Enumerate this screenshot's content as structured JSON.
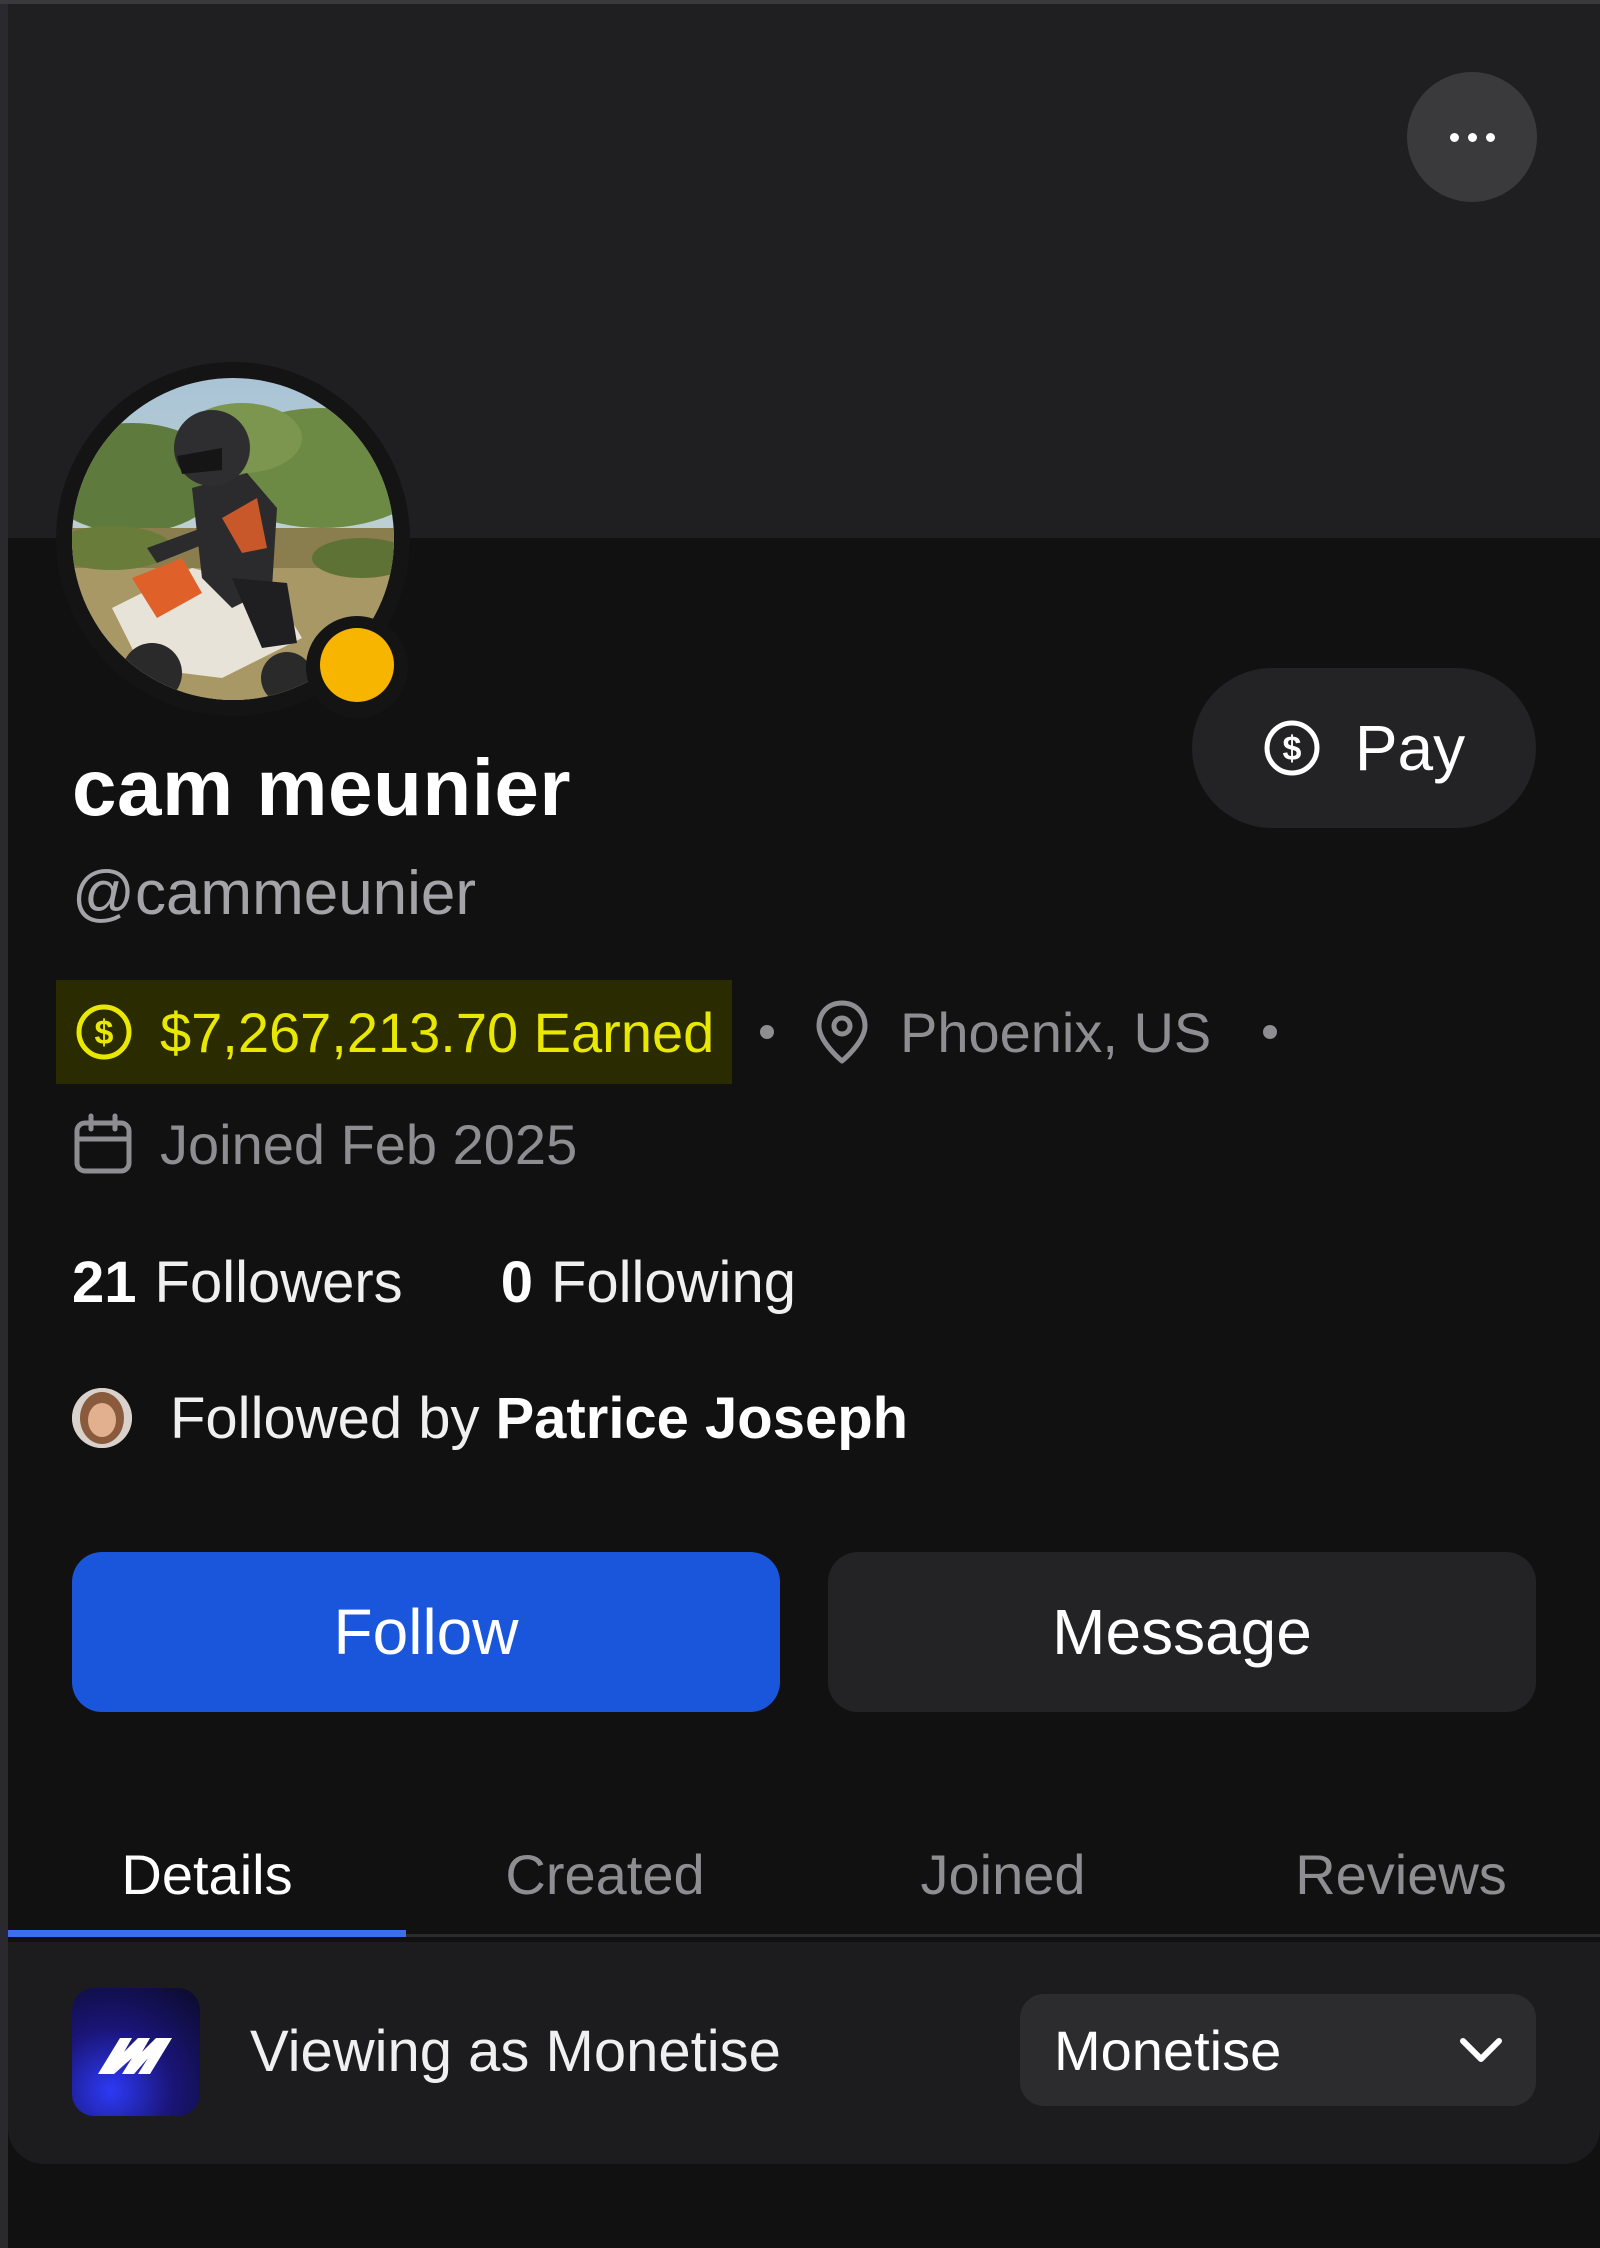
{
  "colors": {
    "background": "#111112",
    "banner": "#1f1f21",
    "accent_blue": "#1a56db",
    "tab_indicator": "#3b6ff0",
    "earned_text": "#e8e800",
    "earned_highlight": "#2b2b00",
    "status_online": "#f8b500",
    "muted_text": "#8e8e92"
  },
  "header": {
    "more_icon": "more-horizontal-icon"
  },
  "profile": {
    "avatar_icon": "profile-photo",
    "status_icon": "status-dot",
    "display_name": "cam meunier",
    "handle": "@cammeunier",
    "earned_icon": "dollar-circle-icon",
    "earned": "$7,267,213.70 Earned",
    "location_icon": "map-pin-icon",
    "location": "Phoenix, US",
    "joined_icon": "calendar-icon",
    "joined": "Joined Feb 2025"
  },
  "pay_button": {
    "icon": "dollar-circle-icon",
    "label": "Pay"
  },
  "stats": {
    "followers_count": "21",
    "followers_label": "Followers",
    "following_count": "0",
    "following_label": "Following"
  },
  "followed_by": {
    "prefix": "Followed by",
    "name": "Patrice Joseph"
  },
  "actions": {
    "follow_label": "Follow",
    "message_label": "Message"
  },
  "tabs": [
    {
      "label": "Details",
      "active": true
    },
    {
      "label": "Created",
      "active": false
    },
    {
      "label": "Joined",
      "active": false
    },
    {
      "label": "Reviews",
      "active": false
    }
  ],
  "viewing_as": {
    "logo_icon": "monetise-logo",
    "label": "Viewing as Monetise",
    "selected": "Monetise",
    "chevron_icon": "chevron-down-icon"
  }
}
